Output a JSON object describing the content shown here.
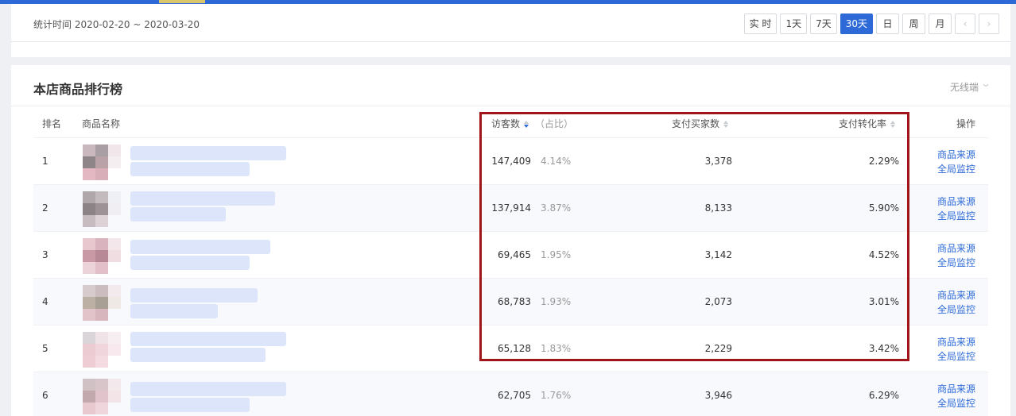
{
  "header": {
    "time_range_label": "统计时间 2020-02-20 ~ 2020-03-20",
    "range_buttons": [
      "实 时",
      "1天",
      "7天",
      "30天",
      "日",
      "周",
      "月"
    ],
    "active_range": "30天",
    "prev_icon": "chevron-left-icon",
    "next_icon": "chevron-right-icon"
  },
  "ranking": {
    "title": "本店商品排行榜",
    "device_select": "无线端",
    "columns": {
      "rank": "排名",
      "name": "商品名称",
      "visitors": "访客数",
      "share": "（占比）",
      "buyers": "支付买家数",
      "rate": "支付转化率",
      "ops": "操作"
    },
    "rows": [
      {
        "rank": "1",
        "visitors": "147,409",
        "share": "4.14%",
        "buyers": "3,378",
        "rate": "2.29%",
        "op_source": "商品来源",
        "op_monitor": "全局监控"
      },
      {
        "rank": "2",
        "visitors": "137,914",
        "share": "3.87%",
        "buyers": "8,133",
        "rate": "5.90%",
        "op_source": "商品来源",
        "op_monitor": "全局监控"
      },
      {
        "rank": "3",
        "visitors": "69,465",
        "share": "1.95%",
        "buyers": "3,142",
        "rate": "4.52%",
        "op_source": "商品来源",
        "op_monitor": "全局监控"
      },
      {
        "rank": "4",
        "visitors": "68,783",
        "share": "1.93%",
        "buyers": "2,073",
        "rate": "3.01%",
        "op_source": "商品来源",
        "op_monitor": "全局监控"
      },
      {
        "rank": "5",
        "visitors": "65,128",
        "share": "1.83%",
        "buyers": "2,229",
        "rate": "3.42%",
        "op_source": "商品来源",
        "op_monitor": "全局监控"
      },
      {
        "rank": "6",
        "visitors": "62,705",
        "share": "1.76%",
        "buyers": "3,946",
        "rate": "6.29%",
        "op_source": "商品来源",
        "op_monitor": "全局监控"
      }
    ]
  },
  "colors": {
    "accent": "#2d6ad8",
    "highlight_box": "#a01518",
    "thumbnail_blur": [
      "#b9a3a9",
      "#c9b8bd",
      "#8e8589",
      "#e3b8c2",
      "#d8aeb9",
      "#a89ea3"
    ],
    "name_blur": "#dde5fb"
  }
}
